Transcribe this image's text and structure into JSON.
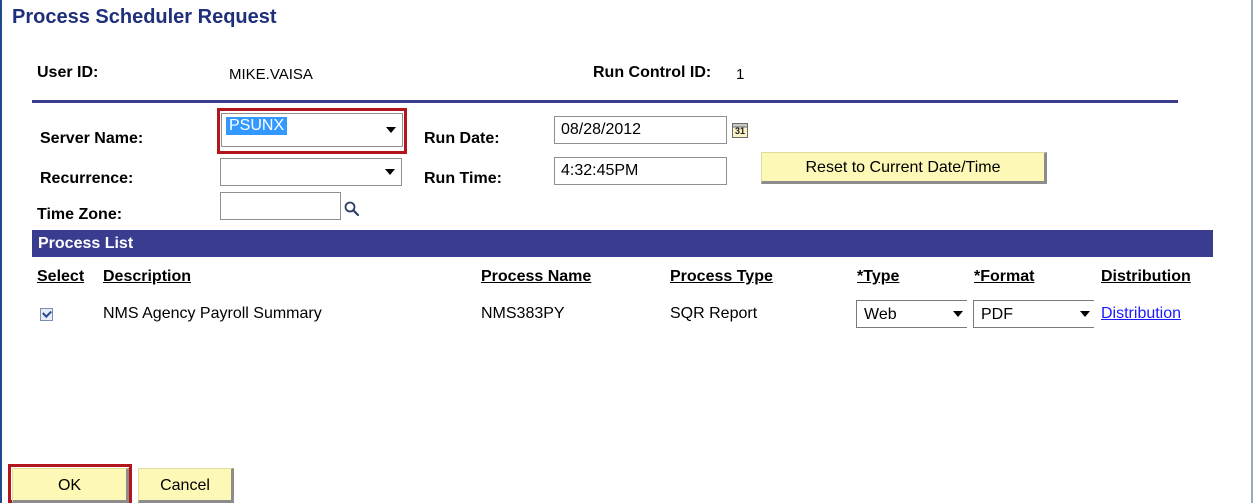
{
  "window": {
    "title": "Process Scheduler Request"
  },
  "header": {
    "user_id_label": "User ID:",
    "user_id_value": "MIKE.VAISA",
    "run_control_label": "Run Control ID:",
    "run_control_value": "1"
  },
  "form": {
    "server_name_label": "Server Name:",
    "server_name_value": "PSUNX",
    "recurrence_label": "Recurrence:",
    "recurrence_value": "",
    "time_zone_label": "Time Zone:",
    "time_zone_value": "",
    "run_date_label": "Run Date:",
    "run_date_value": "08/28/2012",
    "run_time_label": "Run Time:",
    "run_time_value": "4:32:45PM",
    "reset_button_label": "Reset to Current Date/Time",
    "calendar_icon_text": "31"
  },
  "process_list": {
    "title": "Process List",
    "columns": {
      "select": "Select",
      "description": "Description",
      "process_name": "Process Name",
      "process_type": "Process Type",
      "type": "*Type",
      "format": "*Format",
      "distribution": "Distribution"
    },
    "rows": [
      {
        "selected": true,
        "description": "NMS Agency Payroll Summary",
        "process_name": "NMS383PY",
        "process_type": "SQR Report",
        "type": "Web",
        "format": "PDF",
        "distribution_link": "Distribution"
      }
    ]
  },
  "footer": {
    "ok_label": "OK",
    "cancel_label": "Cancel"
  },
  "colors": {
    "title": "#1f2f7a",
    "bar": "#3a3d8f",
    "button": "#fdf8b5",
    "highlight_frame": "#b2151b",
    "selection": "#3399ff",
    "link": "#1a1aff"
  }
}
